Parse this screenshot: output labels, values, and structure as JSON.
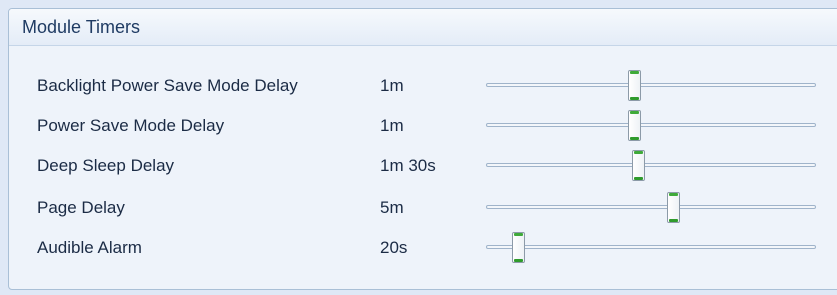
{
  "panel": {
    "title": "Module Timers"
  },
  "timers": [
    {
      "label": "Backlight Power Save Mode Delay",
      "value": "1m",
      "slider_fraction": 0.45
    },
    {
      "label": "Power Save Mode Delay",
      "value": "1m",
      "slider_fraction": 0.45
    },
    {
      "label": "Deep Sleep Delay",
      "value": "1m 30s",
      "slider_fraction": 0.465
    },
    {
      "label": "Page Delay",
      "value": "5m",
      "slider_fraction": 0.57
    },
    {
      "label": "Audible Alarm",
      "value": "20s",
      "slider_fraction": 0.1
    }
  ],
  "colors": {
    "accent": "#3faa3a",
    "header_text": "#1f3b63"
  }
}
